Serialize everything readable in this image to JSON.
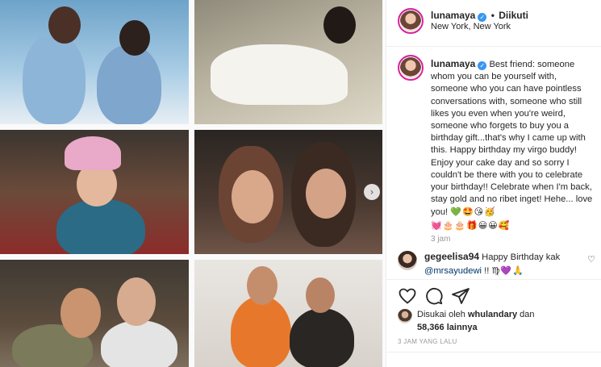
{
  "post": {
    "username": "lunamaya",
    "follow_status": "Diikuti",
    "location": "New York, New York",
    "caption": "Best friend: someone whom you can be yourself with, someone who you can have pointless conversations with, someone who still likes you even when you're weird, someone who forgets to buy you a birthday gift...that's why I came up with this. Happy birthday my virgo buddy! Enjoy your cake day and so sorry I couldn't be there with you to celebrate your birthday!! Celebrate when I'm back, stay gold and no ribet inget! Hehe... love you!",
    "caption_emojis_1": "💚🤩😘🥳",
    "caption_emojis_2": "💓🎂🎂🎁😀😀🥰",
    "time_ago": "3 jam",
    "timestamp": "3 JAM YANG LALU"
  },
  "comment": {
    "username": "gegeelisa94",
    "text": "Happy Birthday kak",
    "mention": "@mrsayudewi",
    "suffix": "!!",
    "emojis": "♍💜🙏"
  },
  "likes": {
    "prefix": "Disukai oleh",
    "user": "whulandary",
    "connector": "dan",
    "count": "58,366",
    "suffix": "lainnya"
  },
  "icons": {
    "verified": "verified-check-icon",
    "next": "chevron-right-icon",
    "like": "heart-icon",
    "comment": "comment-bubble-icon",
    "share": "paper-plane-icon",
    "comment_like": "heart-icon"
  },
  "colors": {
    "verified_blue": "#3897f0",
    "story_ring": "#d6249f",
    "text": "#262626",
    "muted": "#999999",
    "mention": "#003569"
  }
}
